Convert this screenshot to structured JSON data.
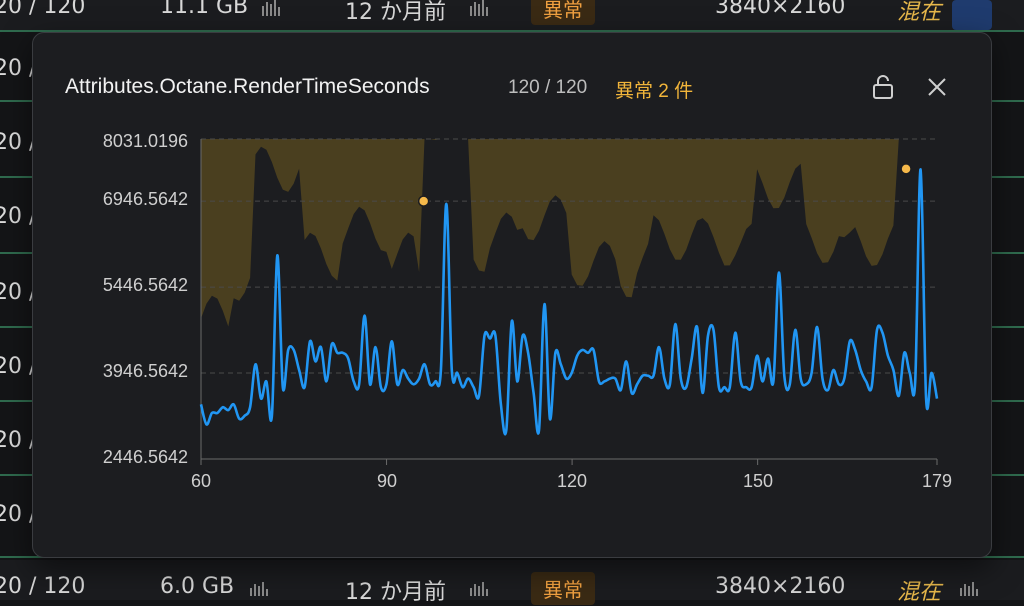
{
  "background": {
    "top_row": {
      "count": "20 / 120",
      "size": "11.1 GB",
      "date": "12 か月前",
      "badge": "異常",
      "resolution": "3840×2160",
      "status": "混在"
    },
    "row_fragment": "20 /",
    "bottom_row": {
      "count": "20 / 120",
      "size": "6.0 GB",
      "date": "12 か月前",
      "badge": "異常",
      "resolution": "3840×2160",
      "status": "混在"
    }
  },
  "modal": {
    "title": "Attributes.Octane.RenderTimeSeconds",
    "count": "120 / 120",
    "anomaly_label": "異常 2 件",
    "lock_icon": "lock-open-icon",
    "close_icon": "close-icon"
  },
  "colors": {
    "line": "#2196f3",
    "band": "#4a3f1f",
    "anomaly_dot": "#f5b84a"
  },
  "chart_data": {
    "type": "line",
    "xlim": [
      60,
      179
    ],
    "ylim": [
      2446.5642,
      8031.0196
    ],
    "x_ticks": [
      "60",
      "90",
      "120",
      "150",
      "179"
    ],
    "y_ticks": [
      "8031.0196",
      "6946.5642",
      "5446.5642",
      "3946.5642",
      "2446.5642"
    ],
    "y_tick_values": [
      8031.0196,
      6946.5642,
      5446.5642,
      3946.5642,
      2446.5642
    ],
    "series": [
      {
        "values": [
          3400,
          3050,
          3250,
          3250,
          3350,
          3300,
          3400,
          3150,
          3200,
          3350,
          4100,
          3500,
          3800,
          3200,
          6000,
          3700,
          4350,
          4350,
          4000,
          3700,
          4500,
          4150,
          4400,
          3800,
          4450,
          4300,
          4300,
          4200,
          3800,
          3750,
          4950,
          3750,
          4400,
          3700,
          3750,
          4500,
          3750,
          4000,
          3850,
          3750,
          3850,
          4100,
          3750,
          3800,
          4000,
          6900,
          4000,
          3950,
          3700,
          3850,
          3700,
          3550,
          4600,
          4550,
          4600,
          3400,
          2950,
          4850,
          3800,
          4600,
          4300,
          3600,
          2950,
          5150,
          3150,
          4300,
          4100,
          3850,
          3950,
          4250,
          4350,
          4300,
          4350,
          3800,
          3800,
          3850,
          3850,
          3650,
          4150,
          3600,
          3750,
          3900,
          3900,
          3900,
          4400,
          3850,
          3750,
          4800,
          3850,
          3700,
          4200,
          4750,
          3600,
          4600,
          4700,
          3700,
          3700,
          3700,
          4650,
          3800,
          3700,
          3700,
          4250,
          3800,
          4200,
          3800,
          5700,
          3900,
          3750,
          4700,
          3850,
          3750,
          3950,
          4750,
          3850,
          3650,
          4000,
          3750,
          3850,
          4500,
          4350,
          4000,
          3800,
          3700,
          4700,
          4650,
          4250,
          4000,
          3550,
          4300,
          3950,
          3800,
          7500,
          3500,
          3950,
          3500
        ]
      }
    ],
    "anomalies": [
      {
        "x": 96,
        "y": 6946.5642
      },
      {
        "x": 174,
        "y": 7510
      }
    ]
  }
}
